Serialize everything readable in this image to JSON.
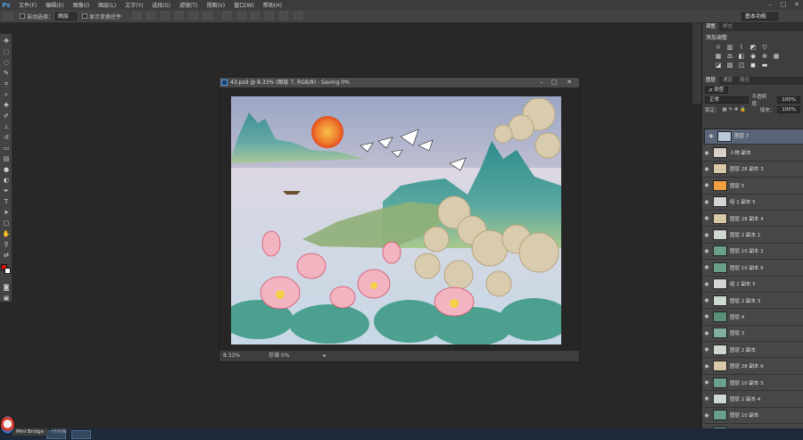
{
  "menubar": {
    "logo": "Ps",
    "items": [
      "文件(F)",
      "编辑(E)",
      "图像(I)",
      "图层(L)",
      "文字(Y)",
      "选择(S)",
      "滤镜(T)",
      "视图(V)",
      "窗口(W)",
      "帮助(H)"
    ],
    "minimize": "–",
    "maximize": "□",
    "close": "✕"
  },
  "options": {
    "auto_select_label": "自动选择：",
    "auto_select_value": "图层",
    "transform_label": "显示变换控件",
    "workspace": "基本功能"
  },
  "document": {
    "title": "43.psd @ 8.33% (图层 7, RGB/8) - Saving 0%",
    "zoom": "8.33%",
    "save_status": "存储 0%"
  },
  "panels": {
    "adjust_tab": "调整",
    "style_tab": "样式",
    "add_adjust": "添加调整",
    "layers_tab": "图层",
    "channels_tab": "通道",
    "paths_tab": "路径",
    "kind_label": "ρ 类型",
    "blend_mode": "正常",
    "opacity_label": "不透明度：",
    "opacity_value": "100%",
    "lock_label": "锁定：",
    "fill_label": "填充：",
    "fill_value": "100%"
  },
  "layers": [
    {
      "name": "图层 7",
      "selected": true,
      "thumb": "#b9c7d6"
    },
    {
      "name": "人物 副本",
      "selected": false,
      "thumb": "#d8d0c8"
    },
    {
      "name": "图层 28 副本 3",
      "selected": false,
      "thumb": "#d9c9a8"
    },
    {
      "name": "图层 5",
      "selected": false,
      "thumb": "#f0a040"
    },
    {
      "name": "组 1 副本 5",
      "selected": false,
      "thumb": "#d5d5d5"
    },
    {
      "name": "图层 28 副本 4",
      "selected": false,
      "thumb": "#d9c9a8"
    },
    {
      "name": "图层 2 副本 2",
      "selected": false,
      "thumb": "#cdd9d0"
    },
    {
      "name": "图层 10 副本 2",
      "selected": false,
      "thumb": "#6aa08a"
    },
    {
      "name": "图层 10 副本 6",
      "selected": false,
      "thumb": "#6aa08a"
    },
    {
      "name": "组 2 副本 5",
      "selected": false,
      "thumb": "#d5d5d5"
    },
    {
      "name": "图层 2 副本 3",
      "selected": false,
      "thumb": "#cdd9d0"
    },
    {
      "name": "图层 4",
      "selected": false,
      "thumb": "#5b8f7a"
    },
    {
      "name": "图层 3",
      "selected": false,
      "thumb": "#7fb0a0"
    },
    {
      "name": "图层 2 副本",
      "selected": false,
      "thumb": "#cdd9d0"
    },
    {
      "name": "图层 28 副本 6",
      "selected": false,
      "thumb": "#d9c9a8"
    },
    {
      "name": "图层 10 副本 5",
      "selected": false,
      "thumb": "#6aa08a"
    },
    {
      "name": "图层 2 副本 4",
      "selected": false,
      "thumb": "#cdd9d0"
    },
    {
      "name": "图层 10 副本",
      "selected": false,
      "thumb": "#6aa08a"
    },
    {
      "name": "图层 10",
      "selected": false,
      "thumb": "#6aa08a"
    }
  ],
  "bottom": {
    "mini_bridge": "Mini Bridge",
    "timeline": "时间轴"
  },
  "colors": {
    "foreground": "#e01010",
    "background": "#ffffff",
    "selected_layer": "#5a6478"
  }
}
